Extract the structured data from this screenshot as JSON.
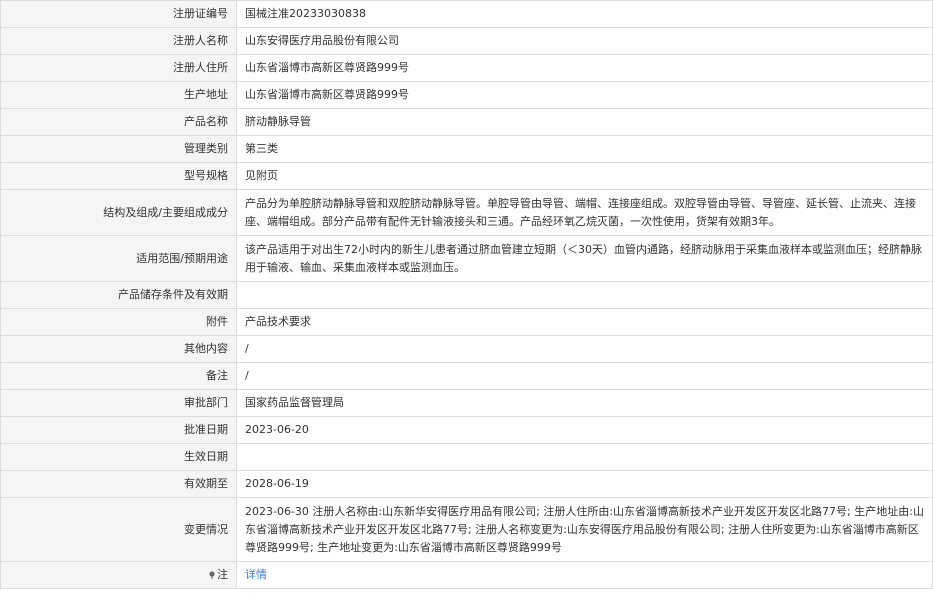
{
  "rows": [
    {
      "label": "注册证编号",
      "value": "国械注准20233030838"
    },
    {
      "label": "注册人名称",
      "value": "山东安得医疗用品股份有限公司"
    },
    {
      "label": "注册人住所",
      "value": "山东省淄博市高新区尊贤路999号"
    },
    {
      "label": "生产地址",
      "value": "山东省淄博市高新区尊贤路999号"
    },
    {
      "label": "产品名称",
      "value": "脐动静脉导管"
    },
    {
      "label": "管理类别",
      "value": "第三类"
    },
    {
      "label": "型号规格",
      "value": "见附页"
    },
    {
      "label": "结构及组成/主要组成成分",
      "value": "产品分为单腔脐动静脉导管和双腔脐动静脉导管。单腔导管由导管、端帽、连接座组成。双腔导管由导管、导管座、延长管、止流夹、连接座、端帽组成。部分产品带有配件无针输液接头和三通。产品经环氧乙烷灭菌，一次性使用，货架有效期3年。"
    },
    {
      "label": "适用范围/预期用途",
      "value": "该产品适用于对出生72小时内的新生儿患者通过脐血管建立短期（＜30天）血管内通路，经脐动脉用于采集血液样本或监测血压；经脐静脉用于输液、输血、采集血液样本或监测血压。"
    },
    {
      "label": "产品储存条件及有效期",
      "value": ""
    },
    {
      "label": "附件",
      "value": "产品技术要求"
    },
    {
      "label": "其他内容",
      "value": "/"
    },
    {
      "label": "备注",
      "value": "/"
    },
    {
      "label": "审批部门",
      "value": "国家药品监督管理局"
    },
    {
      "label": "批准日期",
      "value": "2023-06-20"
    },
    {
      "label": "生效日期",
      "value": ""
    },
    {
      "label": "有效期至",
      "value": "2028-06-19"
    },
    {
      "label": "变更情况",
      "value": "2023-06-30 注册人名称由:山东新华安得医疗用品有限公司; 注册人住所由:山东省淄博高新技术产业开发区开发区北路77号; 生产地址由:山东省淄博高新技术产业开发区开发区北路77号; 注册人名称变更为:山东安得医疗用品股份有限公司; 注册人住所变更为:山东省淄博市高新区尊贤路999号; 生产地址变更为:山东省淄博市高新区尊贤路999号"
    }
  ],
  "note": {
    "label": "注",
    "link": "详情",
    "icon": "pin-icon"
  }
}
